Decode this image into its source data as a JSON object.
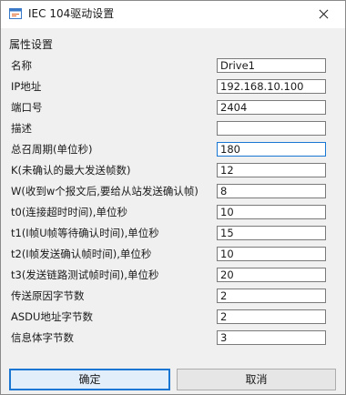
{
  "window": {
    "title": "IEC 104驱动设置",
    "app_icon": "window-app-icon",
    "close_icon": "close-icon"
  },
  "group": {
    "title": "属性设置"
  },
  "properties": [
    {
      "label": "名称",
      "value": "Drive1"
    },
    {
      "label": "IP地址",
      "value": "192.168.10.100"
    },
    {
      "label": "端口号",
      "value": "2404"
    },
    {
      "label": "描述",
      "value": ""
    },
    {
      "label": "总召周期(单位秒)",
      "value": "180"
    },
    {
      "label": "K(未确认的最大发送帧数)",
      "value": "12"
    },
    {
      "label": "W(收到w个报文后,要给从站发送确认帧)",
      "value": "8"
    },
    {
      "label": "t0(连接超时时间),单位秒",
      "value": "10"
    },
    {
      "label": "t1(I帧U帧等待确认时间),单位秒",
      "value": "15"
    },
    {
      "label": "t2(I帧发送确认帧时间),单位秒",
      "value": "10"
    },
    {
      "label": "t3(发送链路测试帧时间),单位秒",
      "value": "20"
    },
    {
      "label": "传送原因字节数",
      "value": "2"
    },
    {
      "label": "ASDU地址字节数",
      "value": "2"
    },
    {
      "label": "信息体字节数",
      "value": "3"
    }
  ],
  "buttons": {
    "ok": "确定",
    "cancel": "取消"
  },
  "colors": {
    "accent": "#1976d2",
    "client_bg": "#f0f0f0"
  }
}
